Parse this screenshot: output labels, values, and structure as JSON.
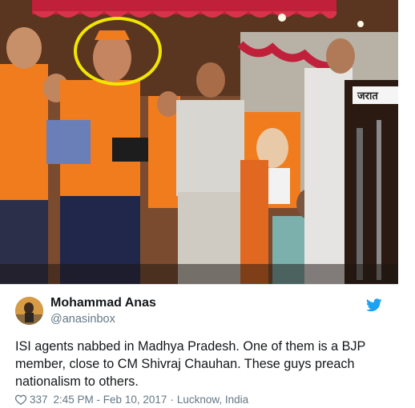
{
  "tweet": {
    "display_name": "Mohammad Anas",
    "handle": "@anasinbox",
    "text": "ISI agents nabbed in Madhya Pradesh. One of them is a BJP member, close to CM Shivraj Chauhan. These guys preach nationalism to others.",
    "likes": "337",
    "time": "2:45 PM - Feb 10, 2017",
    "separator": "·",
    "location": "Lucknow, India"
  },
  "photo": {
    "podium_sign": "जरात"
  },
  "colors": {
    "twitter_blue": "#1da1f2",
    "highlight_circle": "#f2e600",
    "saffron": "#f07c1e",
    "text_primary": "#14171a",
    "text_secondary": "#657786"
  },
  "icons": {
    "brand": "twitter-bird-icon",
    "like": "heart-icon"
  }
}
